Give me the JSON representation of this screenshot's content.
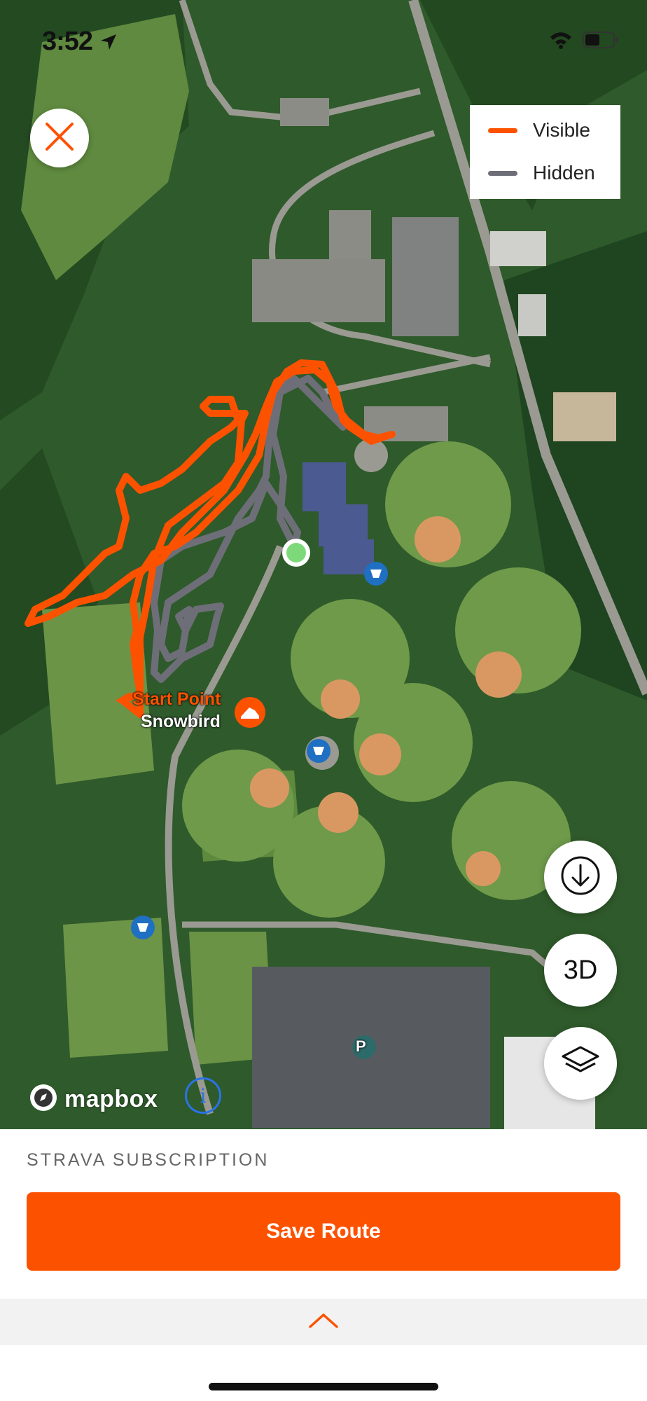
{
  "status_bar": {
    "time": "3:52"
  },
  "legend": {
    "items": [
      {
        "label": "Visible",
        "color": "#fc5200"
      },
      {
        "label": "Hidden",
        "color": "#6e6e78"
      }
    ]
  },
  "map": {
    "start_point_label": "Start Point",
    "segment_name": "Snowbird",
    "attribution": "mapbox",
    "info_symbol": "i",
    "parking_symbol": "P",
    "three_d_label": "3D",
    "icons": [
      "close-icon",
      "download-icon",
      "layers-icon",
      "restroom-icon",
      "parking-icon",
      "running-shoe-icon",
      "location-arrow-icon",
      "wifi-icon",
      "battery-icon"
    ]
  },
  "sheet": {
    "subscription_label": "STRAVA SUBSCRIPTION",
    "save_label": "Save Route"
  },
  "colors": {
    "accent": "#fc5200",
    "hidden_route": "#6e6e78",
    "start_dot": "#7ed97a"
  }
}
